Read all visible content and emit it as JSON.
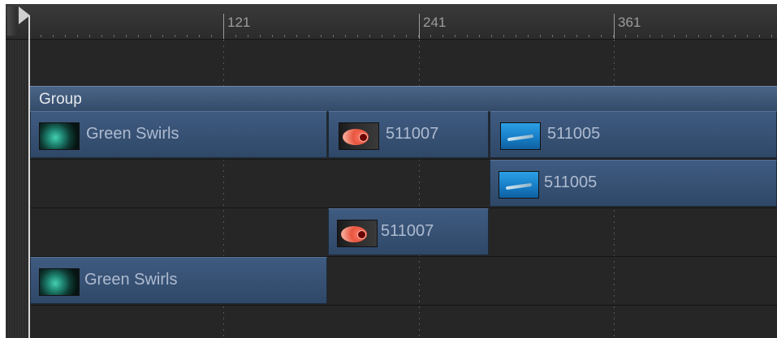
{
  "ruler": {
    "tick_labels": [
      "121",
      "241",
      "361"
    ]
  },
  "group": {
    "label": "Group"
  },
  "clips": {
    "row1": [
      {
        "label": "Green Swirls",
        "thumbnail_icon": "green-swirls-thumbnail"
      },
      {
        "label": "511007",
        "thumbnail_icon": "fish-thumbnail"
      },
      {
        "label": "511005",
        "thumbnail_icon": "ocean-thumbnail"
      }
    ],
    "row2": [
      {
        "label": "511005",
        "thumbnail_icon": "ocean-thumbnail"
      }
    ],
    "row3": [
      {
        "label": "511007",
        "thumbnail_icon": "fish-thumbnail"
      }
    ],
    "row4": [
      {
        "label": "Green Swirls",
        "thumbnail_icon": "green-swirls-thumbnail"
      }
    ]
  },
  "colors": {
    "background": "#262626",
    "clip_accent": "#3f5b80",
    "playhead": "#d8d8d8"
  }
}
